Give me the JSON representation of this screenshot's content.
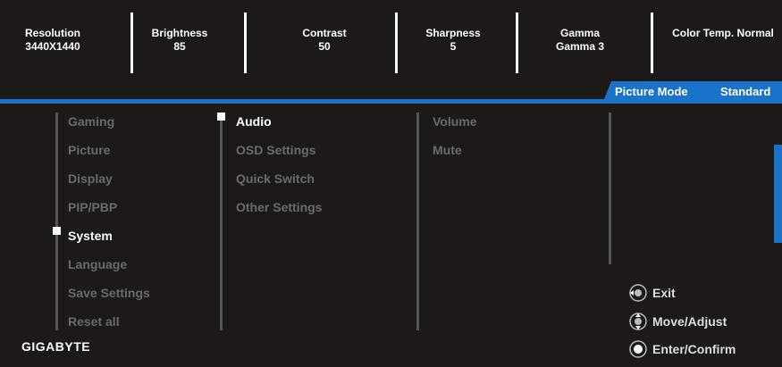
{
  "header": [
    {
      "title": "Resolution",
      "value": "3440X1440"
    },
    {
      "title": "Brightness",
      "value": "85"
    },
    {
      "title": "Contrast",
      "value": "50"
    },
    {
      "title": "Sharpness",
      "value": "5"
    },
    {
      "title": "Gamma",
      "value": "Gamma 3"
    },
    {
      "title": "Color Temp. Normal",
      "value": ""
    }
  ],
  "picture_mode": {
    "label": "Picture Mode",
    "value": "Standard"
  },
  "menu_col1": [
    "Gaming",
    "Picture",
    "Display",
    "PIP/PBP",
    "System",
    "Language",
    "Save Settings",
    "Reset all"
  ],
  "menu_col2": [
    "Audio",
    "OSD Settings",
    "Quick Switch",
    "Other Settings"
  ],
  "menu_col3": [
    "Volume",
    "Mute"
  ],
  "help": [
    {
      "label": "Exit",
      "icon": "joystick-left-icon"
    },
    {
      "label": "Move/Adjust",
      "icon": "joystick-updown-icon"
    },
    {
      "label": "Enter/Confirm",
      "icon": "joystick-press-icon"
    }
  ],
  "brand": "GIGABYTE",
  "colors": {
    "accent": "#1a73c8",
    "background": "#1e1919",
    "inactive_text": "#6a6a6a"
  }
}
